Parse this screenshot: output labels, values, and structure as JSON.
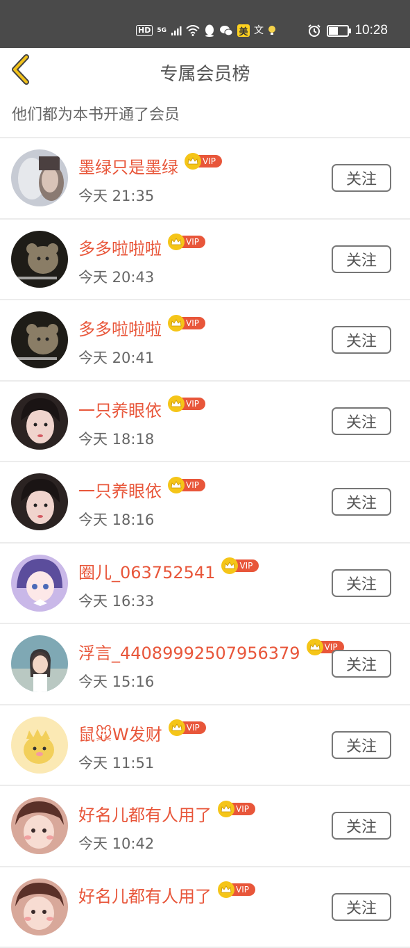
{
  "status_bar": {
    "hd": "HD",
    "network": "5G",
    "mei": "美",
    "wen": "文",
    "time": "10:28",
    "battery_level": 0.45,
    "icons": [
      "wifi-icon",
      "qq-icon",
      "wechat-icon",
      "bulb-icon",
      "alarm-icon"
    ]
  },
  "header": {
    "title": "专属会员榜",
    "back_icon": "chevron-left-icon"
  },
  "subtitle": "他们都为本书开通了会员",
  "vip_label": "VIP",
  "members": [
    {
      "name": "墨绿只是墨绿",
      "time": "今天 21:35",
      "follow": "关注",
      "avatar": "face"
    },
    {
      "name": "多多啦啦啦",
      "time": "今天 20:43",
      "follow": "关注",
      "avatar": "bear"
    },
    {
      "name": "多多啦啦啦",
      "time": "今天 20:41",
      "follow": "关注",
      "avatar": "bear"
    },
    {
      "name": "一只养眼依",
      "time": "今天 18:18",
      "follow": "关注",
      "avatar": "girl"
    },
    {
      "name": "一只养眼依",
      "time": "今天 18:16",
      "follow": "关注",
      "avatar": "girl"
    },
    {
      "name": "圈儿_063752541",
      "time": "今天 16:33",
      "follow": "关注",
      "avatar": "anime"
    },
    {
      "name": "浮言_44089992507956379",
      "time": "今天 15:16",
      "follow": "关注",
      "avatar": "photo"
    },
    {
      "name": "鼠🐭W发财",
      "time": "今天 11:51",
      "follow": "关注",
      "avatar": "cartoon"
    },
    {
      "name": "好名儿都有人用了",
      "time": "今天 10:42",
      "follow": "关注",
      "avatar": "illust"
    },
    {
      "name": "好名儿都有人用了",
      "time": "",
      "follow": "关注",
      "avatar": "illust"
    }
  ],
  "colors": {
    "accent": "#e8563a",
    "crown": "#f5c518",
    "back": "#f2c21a",
    "statusbar": "#4a4a4a"
  }
}
